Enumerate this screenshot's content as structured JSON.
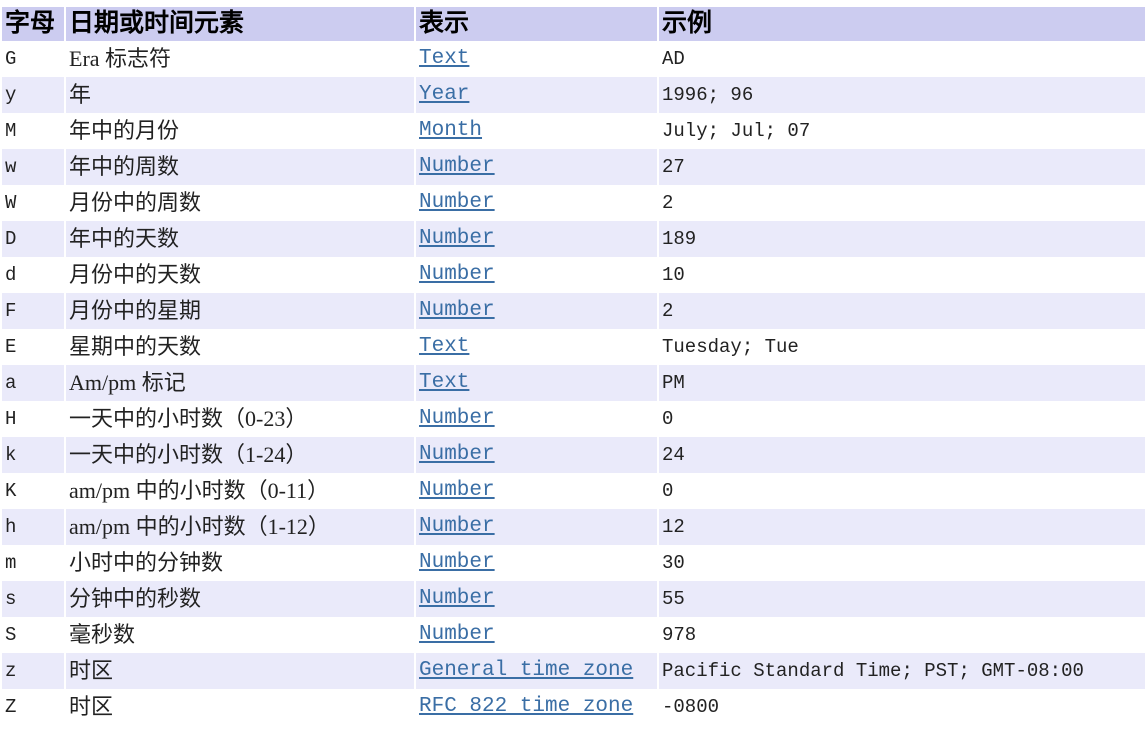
{
  "table": {
    "headers": [
      {
        "id": "letter",
        "label": "字母"
      },
      {
        "id": "element",
        "label": "日期或时间元素"
      },
      {
        "id": "present",
        "label": "表示"
      },
      {
        "id": "example",
        "label": "示例"
      }
    ],
    "rows": [
      {
        "letter": "G",
        "element": "Era 标志符",
        "present": "Text",
        "example": "AD"
      },
      {
        "letter": "y",
        "element": "年",
        "present": "Year",
        "example": "1996; 96"
      },
      {
        "letter": "M",
        "element": "年中的月份",
        "present": "Month",
        "example": "July; Jul; 07"
      },
      {
        "letter": "w",
        "element": "年中的周数",
        "present": "Number",
        "example": "27"
      },
      {
        "letter": "W",
        "element": "月份中的周数",
        "present": "Number",
        "example": "2"
      },
      {
        "letter": "D",
        "element": "年中的天数",
        "present": "Number",
        "example": "189"
      },
      {
        "letter": "d",
        "element": "月份中的天数",
        "present": "Number",
        "example": "10"
      },
      {
        "letter": "F",
        "element": "月份中的星期",
        "present": "Number",
        "example": "2"
      },
      {
        "letter": "E",
        "element": "星期中的天数",
        "present": "Text",
        "example": "Tuesday; Tue"
      },
      {
        "letter": "a",
        "element": "Am/pm 标记",
        "present": "Text",
        "example": "PM"
      },
      {
        "letter": "H",
        "element": "一天中的小时数（0-23）",
        "present": "Number",
        "example": "0"
      },
      {
        "letter": "k",
        "element": "一天中的小时数（1-24）",
        "present": "Number",
        "example": "24"
      },
      {
        "letter": "K",
        "element": "am/pm 中的小时数（0-11）",
        "present": "Number",
        "example": "0"
      },
      {
        "letter": "h",
        "element": "am/pm 中的小时数（1-12）",
        "present": "Number",
        "example": "12"
      },
      {
        "letter": "m",
        "element": "小时中的分钟数",
        "present": "Number",
        "example": "30"
      },
      {
        "letter": "s",
        "element": "分钟中的秒数",
        "present": "Number",
        "example": "55"
      },
      {
        "letter": "S",
        "element": "毫秒数",
        "present": "Number",
        "example": "978"
      },
      {
        "letter": "z",
        "element": "时区",
        "present": "General time zone",
        "example": "Pacific Standard Time; PST; GMT-08:00"
      },
      {
        "letter": "Z",
        "element": "时区",
        "present": "RFC 822 time zone",
        "example": "-0800"
      }
    ]
  },
  "colors": {
    "header_background": "#ccccf0",
    "alt_row_background": "#eaeafa",
    "link": "#3a6ea5",
    "text": "#222222",
    "page_background": "#ffffff"
  }
}
